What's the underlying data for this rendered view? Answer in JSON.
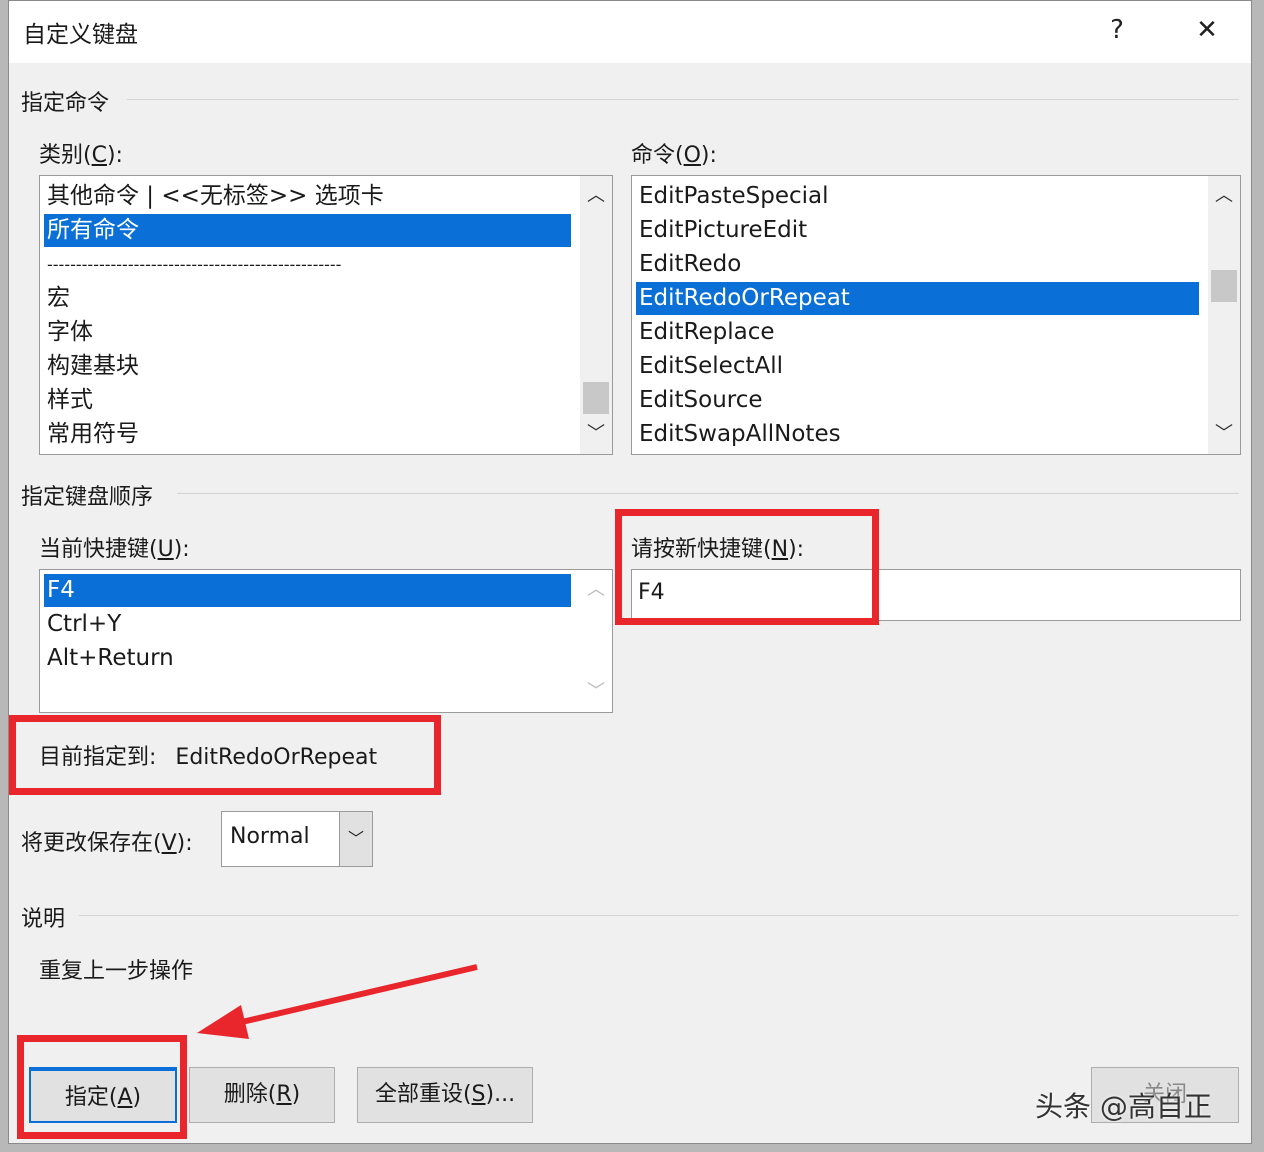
{
  "dialog": {
    "title": "自定义键盘",
    "help_glyph": "?",
    "close_glyph": "✕"
  },
  "assign_command": {
    "section_title": "指定命令",
    "category": {
      "label_pre": "类别(",
      "label_key": "C",
      "label_post": "):",
      "items": [
        "其他命令 | <<无标签>> 选项卡",
        "所有命令",
        "---------------------------------------------------",
        "宏",
        "字体",
        "构建基块",
        "样式",
        "常用符号"
      ],
      "selected_index": 1
    },
    "commands": {
      "label_pre": "命令(",
      "label_key": "O",
      "label_post": "):",
      "items": [
        "EditPasteSpecial",
        "EditPictureEdit",
        "EditRedo",
        "EditRedoOrRepeat",
        "EditReplace",
        "EditSelectAll",
        "EditSource",
        "EditSwapAllNotes"
      ],
      "selected_index": 3
    }
  },
  "keyboard_sequence": {
    "section_title": "指定键盘顺序",
    "current_keys": {
      "label_pre": "当前快捷键(",
      "label_key": "U",
      "label_post": "):",
      "items": [
        "F4",
        "Ctrl+Y",
        "Alt+Return"
      ],
      "selected_index": 0
    },
    "new_key": {
      "label_pre": "请按新快捷键(",
      "label_key": "N",
      "label_post": "):",
      "value": "F4"
    },
    "currently_assigned_label": "目前指定到:",
    "currently_assigned_value": "EditRedoOrRepeat"
  },
  "save_in": {
    "label_pre": "将更改保存在(",
    "label_key": "V",
    "label_post": "):",
    "value": "Normal"
  },
  "description": {
    "section_title": "说明",
    "text": "重复上一步操作"
  },
  "buttons": {
    "assign": {
      "pre": "指定(",
      "key": "A",
      "post": ")"
    },
    "remove": {
      "pre": "删除(",
      "key": "R",
      "post": ")"
    },
    "reset_all": {
      "pre": "全部重设(",
      "key": "S",
      "post": ")..."
    },
    "close_partial": "关闭"
  },
  "watermark": "头条 @高自正",
  "annotation_color": "#e8262b",
  "selection_color": "#0a6fd6"
}
